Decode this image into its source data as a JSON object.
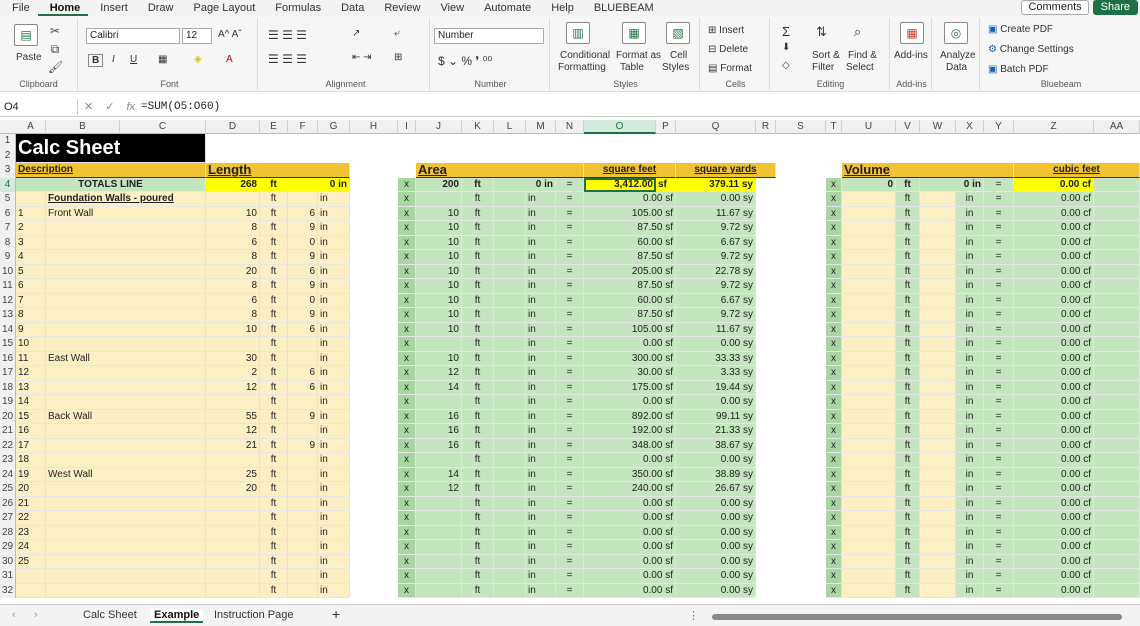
{
  "menu": [
    "File",
    "Home",
    "Insert",
    "Draw",
    "Page Layout",
    "Formulas",
    "Data",
    "Review",
    "View",
    "Automate",
    "Help",
    "BLUEBEAM"
  ],
  "comments": "Comments",
  "share": "Share",
  "ribbon": {
    "paste": "Paste",
    "clipboard": "Clipboard",
    "font_name": "Calibri",
    "font_size": "12",
    "font": "Font",
    "alignment": "Alignment",
    "number_format": "Number",
    "number": "Number",
    "cond_fmt_1": "Conditional",
    "cond_fmt_2": "Formatting",
    "format_table_1": "Format as",
    "format_table_2": "Table",
    "cell_styles_1": "Cell",
    "cell_styles_2": "Styles",
    "styles": "Styles",
    "insert": "Insert",
    "delete": "Delete",
    "format": "Format",
    "cells": "Cells",
    "sort_1": "Sort &",
    "sort_2": "Filter",
    "find_1": "Find &",
    "find_2": "Select",
    "editing": "Editing",
    "addins_btn": "Add-ins",
    "addins": "Add-ins",
    "analyze_1": "Analyze",
    "analyze_2": "Data",
    "create_pdf": "Create PDF",
    "change_settings": "Change Settings",
    "batch_pdf": "Batch PDF",
    "bluebeam": "Bluebeam"
  },
  "namebox": "O4",
  "formula": "=SUM(O5:O60)",
  "columns": [
    "A",
    "B",
    "C",
    "D",
    "E",
    "F",
    "G",
    "H",
    "I",
    "J",
    "K",
    "L",
    "M",
    "N",
    "O",
    "P",
    "Q",
    "R",
    "S",
    "T",
    "U",
    "V",
    "W",
    "X",
    "Y",
    "Z",
    "AA"
  ],
  "sheet": {
    "title": "Calc Sheet",
    "description_label": "Description",
    "length_label": "Length",
    "area_label": "Area",
    "sqft_label": "square feet",
    "sqyd_label": "square yards",
    "volume_label": "Volume",
    "cuft_label": "cubic feet",
    "totals_label": "TOTALS LINE",
    "totals_len_ft": "268",
    "totals_len_in": "0 in",
    "totals_area_ft": "200",
    "totals_area_in": "0 in",
    "totals_sqft": "3,412.00",
    "totals_sqyd": "379.11 sy",
    "totals_vol_ft": "0",
    "totals_vol_in": "0 in",
    "totals_cuft": "0.00 cf",
    "section_label": "Foundation Walls - poured",
    "ft": "ft",
    "in": "in",
    "x": "x",
    "eq": "=",
    "sf": "sf",
    "sy": "sy"
  },
  "rows": [
    {
      "n": "1",
      "desc": "Front Wall",
      "lf": "10",
      "li": "6",
      "wf": "10",
      "sf": "105.00 sf",
      "sy": "11.67 sy"
    },
    {
      "n": "2",
      "desc": "",
      "lf": "8",
      "li": "9",
      "wf": "10",
      "sf": "87.50 sf",
      "sy": "9.72 sy"
    },
    {
      "n": "3",
      "desc": "",
      "lf": "6",
      "li": "0",
      "wf": "10",
      "sf": "60.00 sf",
      "sy": "6.67 sy"
    },
    {
      "n": "4",
      "desc": "",
      "lf": "8",
      "li": "9",
      "wf": "10",
      "sf": "87.50 sf",
      "sy": "9.72 sy"
    },
    {
      "n": "5",
      "desc": "",
      "lf": "20",
      "li": "6",
      "wf": "10",
      "sf": "205.00 sf",
      "sy": "22.78 sy"
    },
    {
      "n": "6",
      "desc": "",
      "lf": "8",
      "li": "9",
      "wf": "10",
      "sf": "87.50 sf",
      "sy": "9.72 sy"
    },
    {
      "n": "7",
      "desc": "",
      "lf": "6",
      "li": "0",
      "wf": "10",
      "sf": "60.00 sf",
      "sy": "6.67 sy"
    },
    {
      "n": "8",
      "desc": "",
      "lf": "8",
      "li": "9",
      "wf": "10",
      "sf": "87.50 sf",
      "sy": "9.72 sy"
    },
    {
      "n": "9",
      "desc": "",
      "lf": "10",
      "li": "6",
      "wf": "10",
      "sf": "105.00 sf",
      "sy": "11.67 sy"
    },
    {
      "n": "10",
      "desc": "",
      "lf": "",
      "li": "",
      "wf": "",
      "sf": "0.00 sf",
      "sy": "0.00 sy"
    },
    {
      "n": "11",
      "desc": "East Wall",
      "lf": "30",
      "li": "",
      "wf": "10",
      "sf": "300.00 sf",
      "sy": "33.33 sy"
    },
    {
      "n": "12",
      "desc": "",
      "lf": "2",
      "li": "6",
      "wf": "12",
      "sf": "30.00 sf",
      "sy": "3.33 sy"
    },
    {
      "n": "13",
      "desc": "",
      "lf": "12",
      "li": "6",
      "wf": "14",
      "sf": "175.00 sf",
      "sy": "19.44 sy"
    },
    {
      "n": "14",
      "desc": "",
      "lf": "",
      "li": "",
      "wf": "",
      "sf": "0.00 sf",
      "sy": "0.00 sy"
    },
    {
      "n": "15",
      "desc": "Back Wall",
      "lf": "55",
      "li": "9",
      "wf": "16",
      "sf": "892.00 sf",
      "sy": "99.11 sy"
    },
    {
      "n": "16",
      "desc": "",
      "lf": "12",
      "li": "",
      "wf": "16",
      "sf": "192.00 sf",
      "sy": "21.33 sy"
    },
    {
      "n": "17",
      "desc": "",
      "lf": "21",
      "li": "9",
      "wf": "16",
      "sf": "348.00 sf",
      "sy": "38.67 sy"
    },
    {
      "n": "18",
      "desc": "",
      "lf": "",
      "li": "",
      "wf": "",
      "sf": "0.00 sf",
      "sy": "0.00 sy"
    },
    {
      "n": "19",
      "desc": "West Wall",
      "lf": "25",
      "li": "",
      "wf": "14",
      "sf": "350.00 sf",
      "sy": "38.89 sy"
    },
    {
      "n": "20",
      "desc": "",
      "lf": "20",
      "li": "",
      "wf": "12",
      "sf": "240.00 sf",
      "sy": "26.67 sy"
    },
    {
      "n": "21",
      "desc": "",
      "lf": "",
      "li": "",
      "wf": "",
      "sf": "0.00 sf",
      "sy": "0.00 sy"
    },
    {
      "n": "22",
      "desc": "",
      "lf": "",
      "li": "",
      "wf": "",
      "sf": "0.00 sf",
      "sy": "0.00 sy"
    },
    {
      "n": "23",
      "desc": "",
      "lf": "",
      "li": "",
      "wf": "",
      "sf": "0.00 sf",
      "sy": "0.00 sy"
    },
    {
      "n": "24",
      "desc": "",
      "lf": "",
      "li": "",
      "wf": "",
      "sf": "0.00 sf",
      "sy": "0.00 sy"
    },
    {
      "n": "25",
      "desc": "",
      "lf": "",
      "li": "",
      "wf": "",
      "sf": "0.00 sf",
      "sy": "0.00 sy"
    },
    {
      "n": "",
      "desc": "",
      "lf": "",
      "li": "",
      "wf": "",
      "sf": "0.00 sf",
      "sy": "0.00 sy"
    },
    {
      "n": "",
      "desc": "",
      "lf": "",
      "li": "",
      "wf": "",
      "sf": "0.00 sf",
      "sy": "0.00 sy"
    }
  ],
  "cf_value": "0.00 cf",
  "tabs": [
    "Calc Sheet",
    "Example",
    "Instruction Page"
  ],
  "add_sheet": "+"
}
